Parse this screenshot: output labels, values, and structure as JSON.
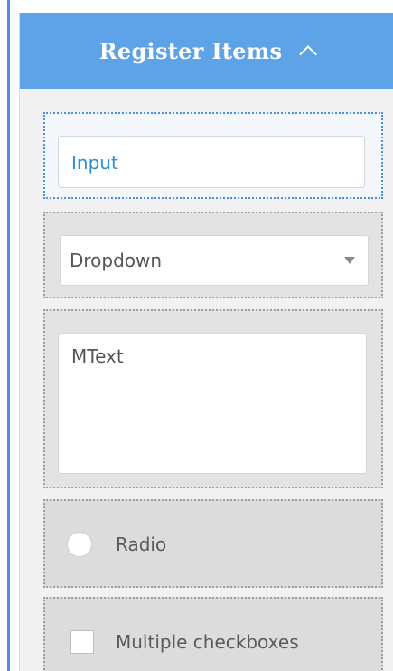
{
  "header": {
    "title": "Register Items"
  },
  "items": {
    "input": {
      "value": "Input"
    },
    "dropdown": {
      "value": "Dropdown"
    },
    "mtext": {
      "value": "MText"
    },
    "radio": {
      "label": "Radio"
    },
    "checkbox": {
      "label": "Multiple checkboxes"
    }
  },
  "colors": {
    "header_bg": "#5ea3e8",
    "selected_border": "#4a90e2",
    "input_text": "#2e8fd6"
  },
  "icons": {
    "collapse": "chevron-up-icon",
    "dropdown": "caret-down-icon"
  }
}
